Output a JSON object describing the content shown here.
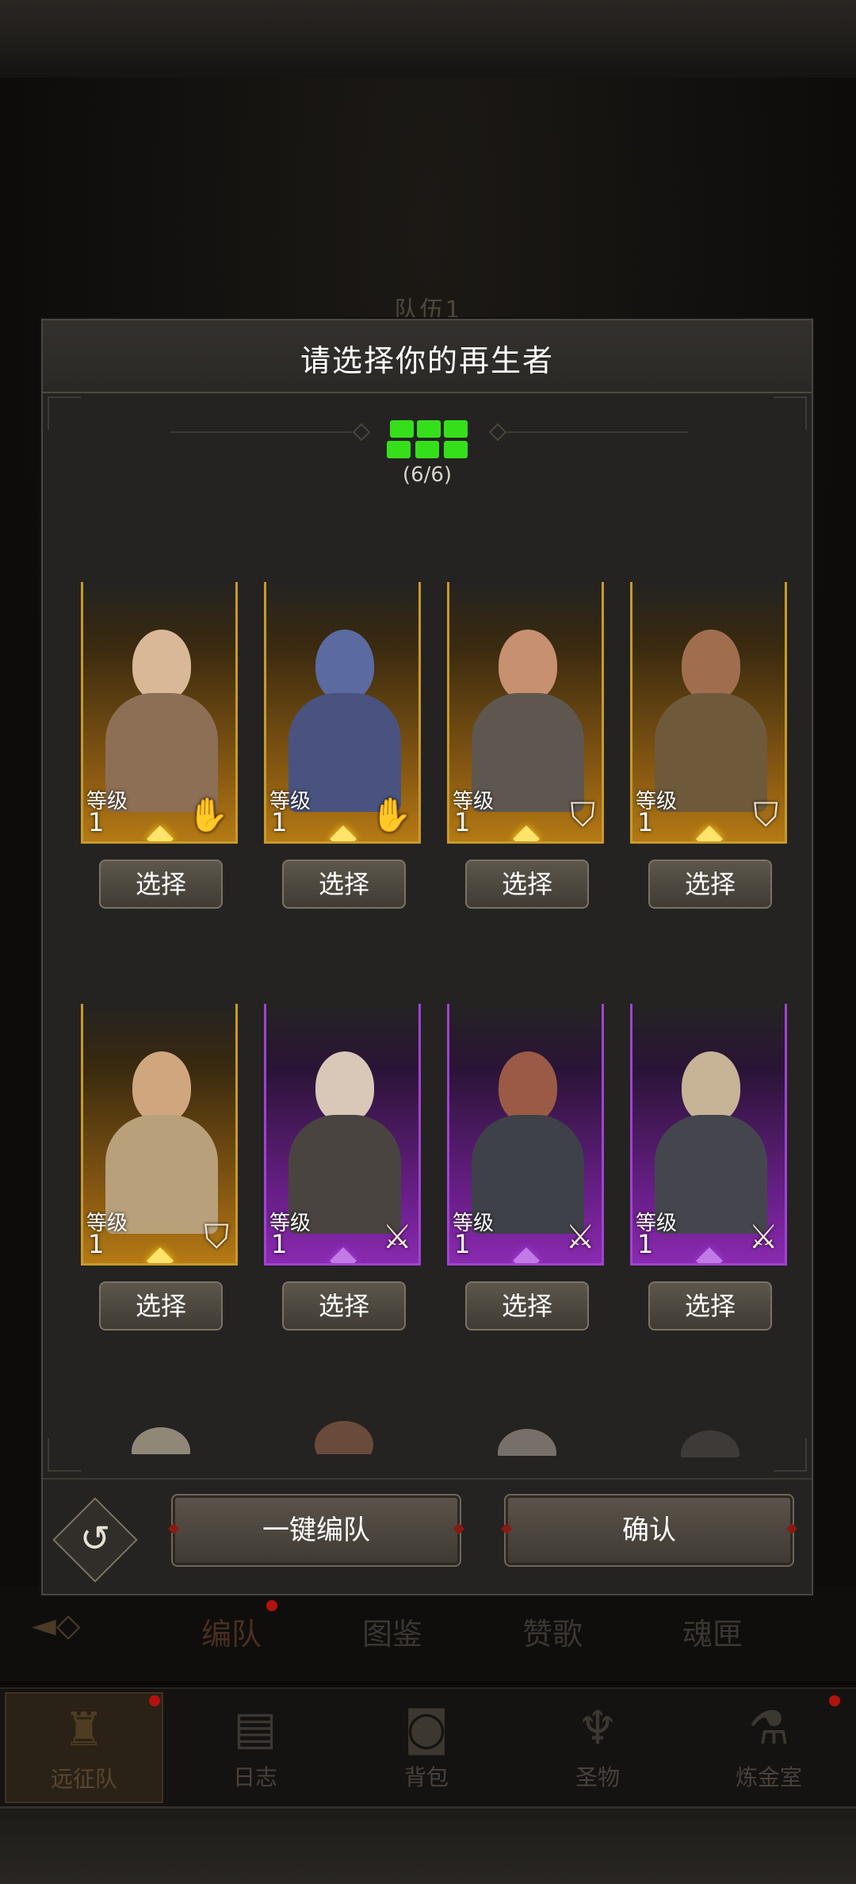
{
  "background": {
    "team_label": "队伍1",
    "sub_tabs": [
      "编队",
      "图鉴",
      "赞歌",
      "魂匣"
    ],
    "nav": [
      {
        "label": "远征队",
        "icon": "viking-helmet-icon"
      },
      {
        "label": "日志",
        "icon": "scroll-icon"
      },
      {
        "label": "背包",
        "icon": "backpack-icon"
      },
      {
        "label": "圣物",
        "icon": "relic-icon"
      },
      {
        "label": "炼金室",
        "icon": "alchemy-icon"
      }
    ]
  },
  "dialog": {
    "title": "请选择你的再生者",
    "count": "(6/6)",
    "reset_icon": "undo-icon",
    "auto_team_label": "一键编队",
    "confirm_label": "确认"
  },
  "heroes": [
    {
      "level_label": "等级",
      "level": "1",
      "rarity": "gold",
      "class_icon": "hand-icon",
      "select": "选择"
    },
    {
      "level_label": "等级",
      "level": "1",
      "rarity": "gold",
      "class_icon": "hand-icon",
      "select": "选择"
    },
    {
      "level_label": "等级",
      "level": "1",
      "rarity": "gold",
      "class_icon": "shield-icon",
      "select": "选择"
    },
    {
      "level_label": "等级",
      "level": "1",
      "rarity": "gold",
      "class_icon": "shield-icon",
      "select": "选择"
    },
    {
      "level_label": "等级",
      "level": "1",
      "rarity": "gold",
      "class_icon": "shield-icon",
      "select": "选择"
    },
    {
      "level_label": "等级",
      "level": "1",
      "rarity": "purple",
      "class_icon": "sword-icon",
      "select": "选择"
    },
    {
      "level_label": "等级",
      "level": "1",
      "rarity": "purple",
      "class_icon": "sword-icon",
      "select": "选择"
    },
    {
      "level_label": "等级",
      "level": "1",
      "rarity": "purple",
      "class_icon": "sword-icon",
      "select": "选择"
    }
  ],
  "colors": {
    "gold_frame": "#c89a2a",
    "purple_frame": "#a043d0",
    "slot_green": "#35e01a",
    "notification_red": "#b3120f"
  }
}
